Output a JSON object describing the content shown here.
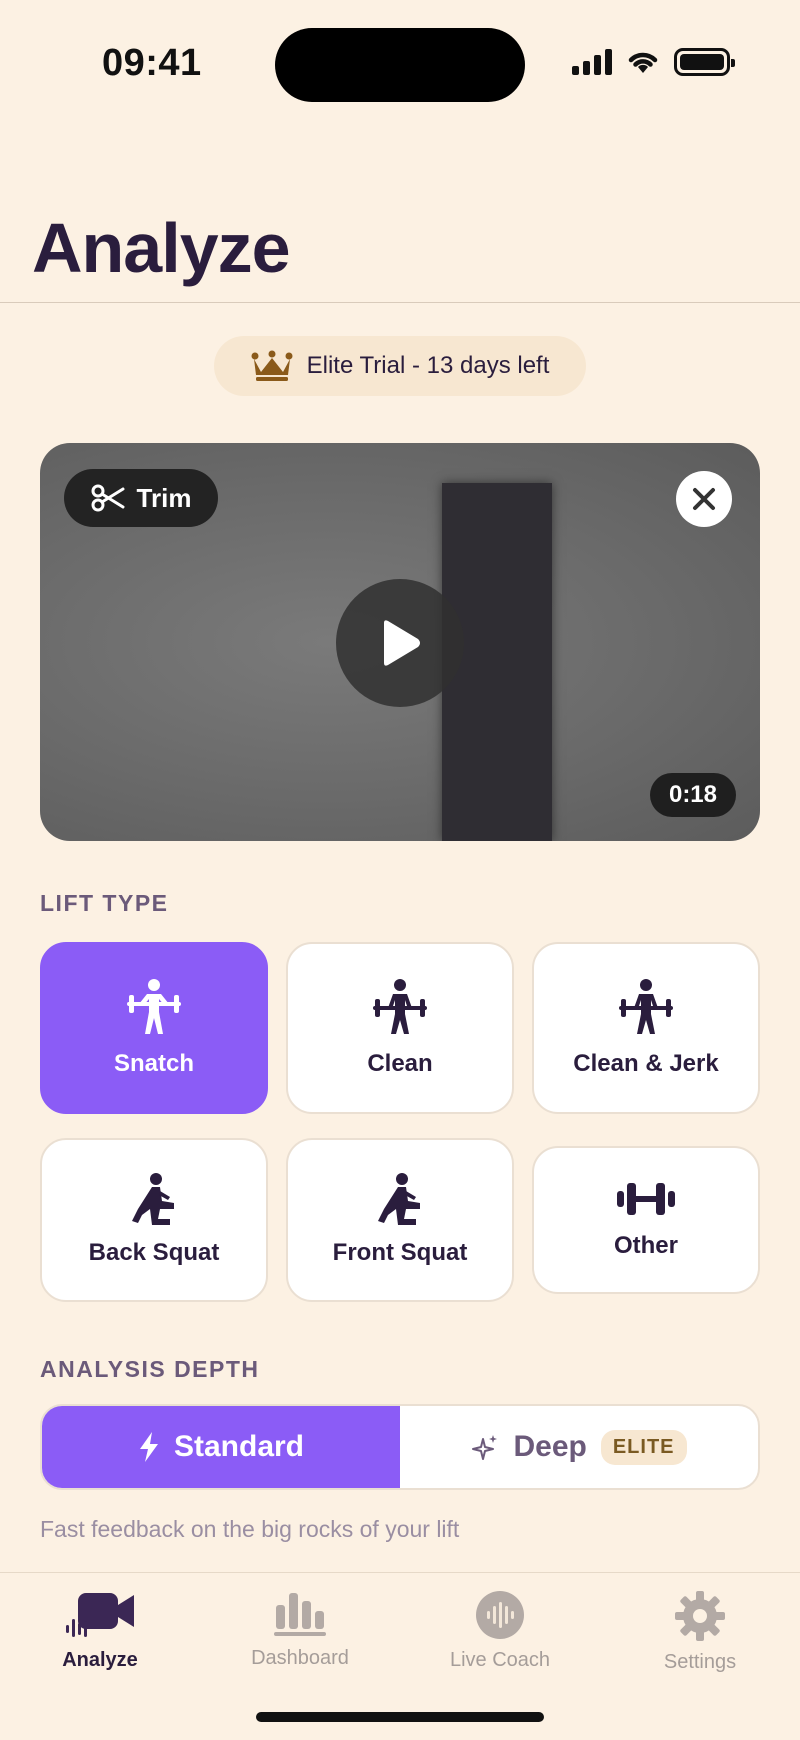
{
  "status_bar": {
    "time": "09:41"
  },
  "header": {
    "title": "Analyze"
  },
  "trial": {
    "label": "Elite Trial - 13 days left",
    "icon": "crown-icon"
  },
  "video": {
    "trim_label": "Trim",
    "duration": "0:18"
  },
  "lift_type": {
    "section_label": "LIFT TYPE",
    "options": [
      {
        "label": "Snatch",
        "selected": true
      },
      {
        "label": "Clean",
        "selected": false
      },
      {
        "label": "Clean & Jerk",
        "selected": false
      },
      {
        "label": "Back Squat",
        "selected": false
      },
      {
        "label": "Front Squat",
        "selected": false
      },
      {
        "label": "Other",
        "selected": false
      }
    ]
  },
  "analysis_depth": {
    "section_label": "ANALYSIS DEPTH",
    "standard_label": "Standard",
    "deep_label": "Deep",
    "elite_badge": "ELITE",
    "selected": "Standard",
    "description": "Fast feedback on the big rocks of your lift"
  },
  "tab_bar": {
    "tabs": [
      {
        "label": "Analyze",
        "icon": "video-camera-icon",
        "active": true
      },
      {
        "label": "Dashboard",
        "icon": "bar-chart-icon",
        "active": false
      },
      {
        "label": "Live Coach",
        "icon": "waveform-icon",
        "active": false
      },
      {
        "label": "Settings",
        "icon": "gear-icon",
        "active": false
      }
    ]
  },
  "colors": {
    "background": "#fcf1e3",
    "accent": "#8b5cf6",
    "text_primary": "#2a1d3d",
    "text_muted": "#9a8ea2",
    "crown": "#8a5a1a"
  }
}
